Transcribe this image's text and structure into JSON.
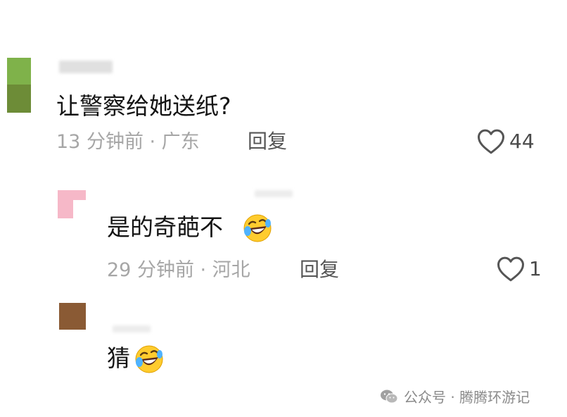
{
  "comments": [
    {
      "text": "让警察给她送纸?",
      "meta": "13 分钟前 · 广东",
      "reply_label": "回复",
      "likes": "44"
    },
    {
      "text": "是的奇葩不",
      "meta": "29 分钟前 · 河北",
      "reply_label": "回复",
      "likes": "1",
      "emoji": "rolling-on-floor-laughing"
    },
    {
      "text": "猜",
      "emoji": "rolling-on-floor-laughing"
    }
  ],
  "watermark": {
    "text": "公众号 · 腾腾环游记",
    "icon": "wechat-icon"
  },
  "colors": {
    "meta_gray": "#a6a6a6",
    "reply_gray": "#555555",
    "text": "#141414"
  }
}
